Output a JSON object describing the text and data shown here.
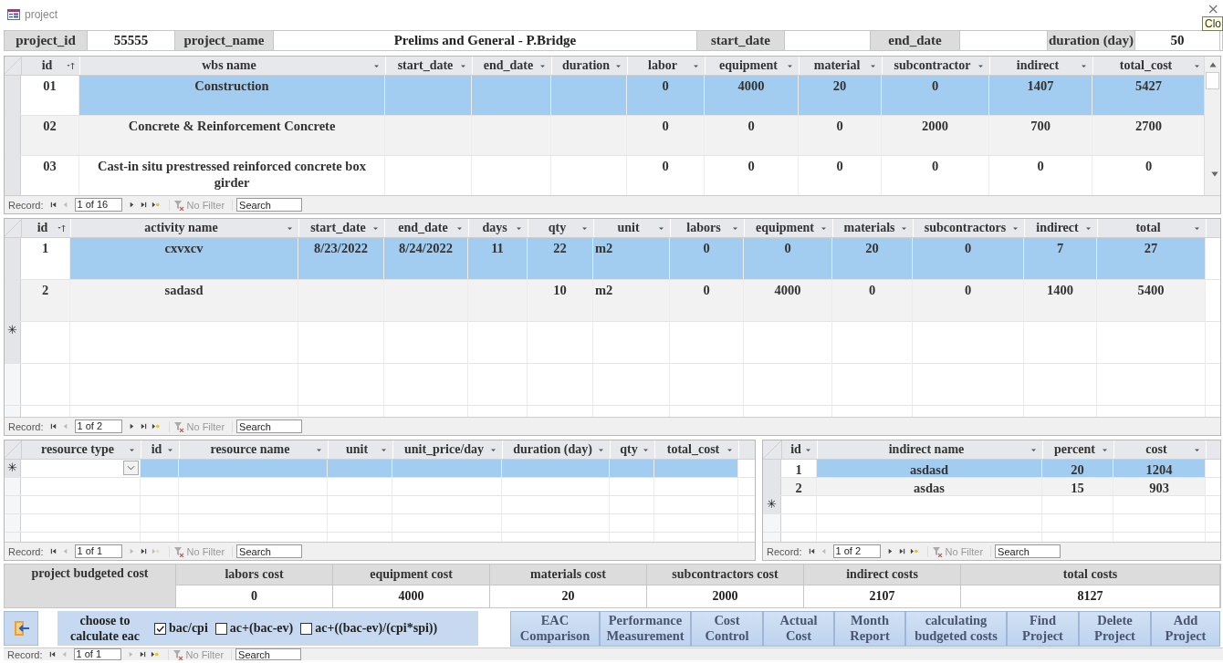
{
  "window": {
    "title": "project",
    "close": "×",
    "tooltip": "Clo"
  },
  "header_fields": [
    {
      "label": "project_id",
      "value": "55555"
    },
    {
      "label": "project_name",
      "value": "Prelims and General - P.Bridge"
    },
    {
      "label": "start_date"
    },
    {
      "label": "end_date"
    },
    {
      "label": "duration (day)",
      "value": "50"
    }
  ],
  "grids": [
    {
      "vertical_scrollbar": true,
      "columns": [
        {
          "label": "id",
          "sorted": true
        },
        {
          "label": "wbs name",
          "sorted": false
        },
        {
          "label": "start_date",
          "sorted": false
        },
        {
          "label": "end_date",
          "sorted": false
        },
        {
          "label": "duration",
          "sorted": false
        },
        {
          "label": "labor",
          "sorted": false
        },
        {
          "label": "equipment",
          "sorted": false
        },
        {
          "label": "material",
          "sorted": false
        },
        {
          "label": "subcontractor",
          "sorted": false
        },
        {
          "label": "indirect",
          "sorted": false
        },
        {
          "label": "total_cost",
          "sorted": false
        }
      ],
      "rows": [
        {
          "kind": "record",
          "selected": true,
          "cells": [
            "01",
            "Construction",
            null,
            null,
            null,
            "0",
            "4000",
            "20",
            "0",
            "1407",
            "5427"
          ]
        },
        {
          "kind": "record",
          "selected": false,
          "cells": [
            "02",
            "Concrete & Reinforcement Concrete",
            null,
            null,
            null,
            "0",
            "0",
            "0",
            "2000",
            "700",
            "2700"
          ]
        },
        {
          "kind": "record",
          "selected": false,
          "cells": [
            "03",
            "Cast-in situ prestressed reinforced concrete box girder",
            null,
            null,
            null,
            "0",
            "0",
            "0",
            "0",
            "0",
            "0"
          ]
        }
      ],
      "nav": {
        "label": "Record:",
        "position": "1 of 16",
        "filter": "No Filter",
        "search_placeholder": "Search",
        "buttons": [
          {
            "kind": "first",
            "disabled": false
          },
          {
            "kind": "prev",
            "disabled": true
          },
          {
            "kind": "next",
            "disabled": false
          },
          {
            "kind": "last",
            "disabled": false
          },
          {
            "kind": "new",
            "disabled": false
          }
        ]
      }
    },
    {
      "columns": [
        {
          "label": "id",
          "sorted": true
        },
        {
          "label": "activity name",
          "sorted": false
        },
        {
          "label": "start_date",
          "sorted": false
        },
        {
          "label": "end_date",
          "sorted": false
        },
        {
          "label": "days",
          "sorted": false
        },
        {
          "label": "qty",
          "sorted": false
        },
        {
          "label": "unit",
          "sorted": false
        },
        {
          "label": "labors",
          "sorted": false
        },
        {
          "label": "equipment",
          "sorted": false
        },
        {
          "label": "materials",
          "sorted": false
        },
        {
          "label": "subcontractors",
          "sorted": false
        },
        {
          "label": "indirect",
          "sorted": false
        },
        {
          "label": "total",
          "sorted": false
        }
      ],
      "rows": [
        {
          "kind": "record",
          "selected": true,
          "cells": [
            "1",
            "cxvxcv",
            "8/23/2022",
            "8/24/2022",
            "11",
            "22",
            "m2",
            "0",
            "0",
            "20",
            "0",
            "7",
            "27"
          ]
        },
        {
          "kind": "record",
          "selected": false,
          "cells": [
            "2",
            "sadasd",
            null,
            null,
            null,
            "10",
            "m2",
            "0",
            "4000",
            "0",
            "0",
            "1400",
            "5400"
          ]
        },
        {
          "kind": "new",
          "marker": "✳",
          "selected": false
        }
      ],
      "nav": {
        "label": "Record:",
        "position": "1 of 2",
        "filter": "No Filter",
        "search_placeholder": "Search",
        "buttons": [
          {
            "kind": "first",
            "disabled": false
          },
          {
            "kind": "prev",
            "disabled": true
          },
          {
            "kind": "next",
            "disabled": false
          },
          {
            "kind": "last",
            "disabled": false
          },
          {
            "kind": "new",
            "disabled": false
          }
        ]
      }
    },
    {
      "columns": [
        {
          "label": "resource type",
          "sorted": false
        },
        {
          "label": "id",
          "sorted": false
        },
        {
          "label": "resource name",
          "sorted": false
        },
        {
          "label": "unit",
          "sorted": false
        },
        {
          "label": "unit_price/day",
          "sorted": false
        },
        {
          "label": "duration (day)",
          "sorted": false
        },
        {
          "label": "qty",
          "sorted": false
        },
        {
          "label": "total_cost",
          "sorted": false
        }
      ],
      "rows": [
        {
          "kind": "new",
          "marker": "✳",
          "selected": true,
          "dropdown": true
        }
      ],
      "nav": {
        "label": "Record:",
        "position": "1 of 1",
        "filter": "No Filter",
        "search_placeholder": "Search",
        "buttons": [
          {
            "kind": "first",
            "disabled": false
          },
          {
            "kind": "prev",
            "disabled": true
          },
          {
            "kind": "next",
            "disabled": true
          },
          {
            "kind": "last",
            "disabled": false
          },
          {
            "kind": "new",
            "disabled": true
          }
        ]
      }
    },
    {
      "columns": [
        {
          "label": "id",
          "sorted": false
        },
        {
          "label": "indirect name",
          "sorted": false
        },
        {
          "label": "percent",
          "sorted": false
        },
        {
          "label": "cost",
          "sorted": false
        }
      ],
      "rows": [
        {
          "kind": "record",
          "selected": true,
          "cells": [
            "1",
            "asdasd",
            "20",
            "1204"
          ]
        },
        {
          "kind": "record",
          "selected": false,
          "cells": [
            "2",
            "asdas",
            "15",
            "903"
          ]
        },
        {
          "kind": "new",
          "marker": "✳",
          "selected": false
        }
      ],
      "nav": {
        "label": "Record:",
        "position": "1 of 2",
        "filter": "No Filter",
        "search_placeholder": "Search",
        "buttons": [
          {
            "kind": "first",
            "disabled": false
          },
          {
            "kind": "prev",
            "disabled": true
          },
          {
            "kind": "next",
            "disabled": false
          },
          {
            "kind": "last",
            "disabled": false
          },
          {
            "kind": "new",
            "disabled": false
          }
        ]
      }
    }
  ],
  "budget": {
    "title": "project budgeted cost",
    "columns": [
      {
        "label": "labors cost",
        "value": "0"
      },
      {
        "label": "equipment cost",
        "value": "4000"
      },
      {
        "label": "materials cost",
        "value": "20"
      },
      {
        "label": "subcontractors cost",
        "value": "2000"
      },
      {
        "label": "indirect costs",
        "value": "2107"
      },
      {
        "label": "total costs",
        "value": "8127"
      }
    ]
  },
  "eac": {
    "label": "choose to calculate eac",
    "options": [
      {
        "label": "bac/cpi",
        "checked": true
      },
      {
        "label": "ac+(bac-ev)",
        "checked": false
      },
      {
        "label": "ac+((bac-ev)/(cpi*spi))",
        "checked": false
      }
    ]
  },
  "buttons": [
    {
      "lines": [
        "EAC",
        "Comparison"
      ]
    },
    {
      "lines": [
        "Performance",
        "Measurement"
      ]
    },
    {
      "lines": [
        "Cost",
        "Control"
      ]
    },
    {
      "lines": [
        "Actual",
        "Cost"
      ]
    },
    {
      "lines": [
        "Month",
        "Report"
      ]
    },
    {
      "lines": [
        "calculating",
        "budgeted costs"
      ]
    },
    {
      "lines": [
        "Find",
        "Project"
      ]
    },
    {
      "lines": [
        "Delete",
        "Project"
      ]
    },
    {
      "lines": [
        "Add",
        "Project"
      ]
    }
  ],
  "form_nav": {
    "label": "Record:",
    "position": "1 of 1",
    "filter": "No Filter",
    "search_placeholder": "Search",
    "buttons": [
      {
        "kind": "first",
        "disabled": false
      },
      {
        "kind": "prev",
        "disabled": true
      },
      {
        "kind": "next",
        "disabled": true
      },
      {
        "kind": "last",
        "disabled": false
      },
      {
        "kind": "new",
        "disabled": false
      }
    ]
  }
}
